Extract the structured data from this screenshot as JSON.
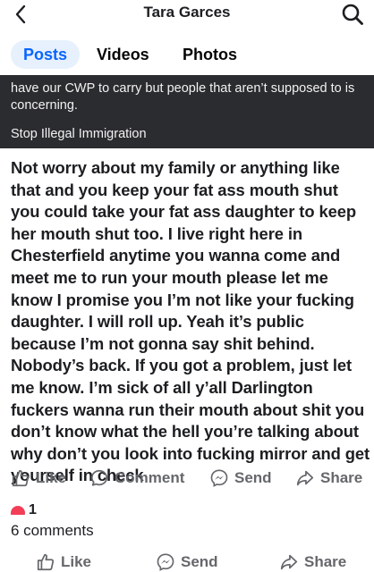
{
  "header": {
    "title": "Tara Garces",
    "icons": {
      "back": "chevron-left-icon",
      "search": "search-icon"
    }
  },
  "tabs": [
    {
      "label": "Posts",
      "active": true
    },
    {
      "label": "Videos",
      "active": false
    },
    {
      "label": "Photos",
      "active": false
    }
  ],
  "caption": {
    "text": "have our CWP to carry but people that aren’t supposed to is concerning.",
    "tag": "Stop Illegal Immigration"
  },
  "post": {
    "body": "Not worry about my family or anything like that and you keep your fat ass mouth shut you could take your fat ass daughter to keep her mouth shut too. I live right here in Chesterfield anytime you wanna come and meet me to run your mouth please let me know I promise you I’m not like your fucking daughter. I will roll up. Yeah it’s public because I’m not gonna say shit behind. Nobody’s back. If you got a problem, just let me know. I’m sick of all y’all Darlington fuckers wanna run their mouth about shit you don’t know what the hell you’re talking about why don’t you look into fucking mirror and get yourself in check"
  },
  "actions": {
    "like": "Like",
    "comment": "Comment",
    "send": "Send",
    "share": "Share"
  },
  "reactions": {
    "count": "1"
  },
  "comments_label": "6 comments",
  "bottom_actions": {
    "like": "Like",
    "send": "Send",
    "share": "Share"
  },
  "colors": {
    "accent": "#0866ff",
    "tab_active_bg": "#e7f0fd",
    "caption_bg": "#2b2c2f",
    "action_gray": "#65676b",
    "reaction": "#f33e58"
  }
}
